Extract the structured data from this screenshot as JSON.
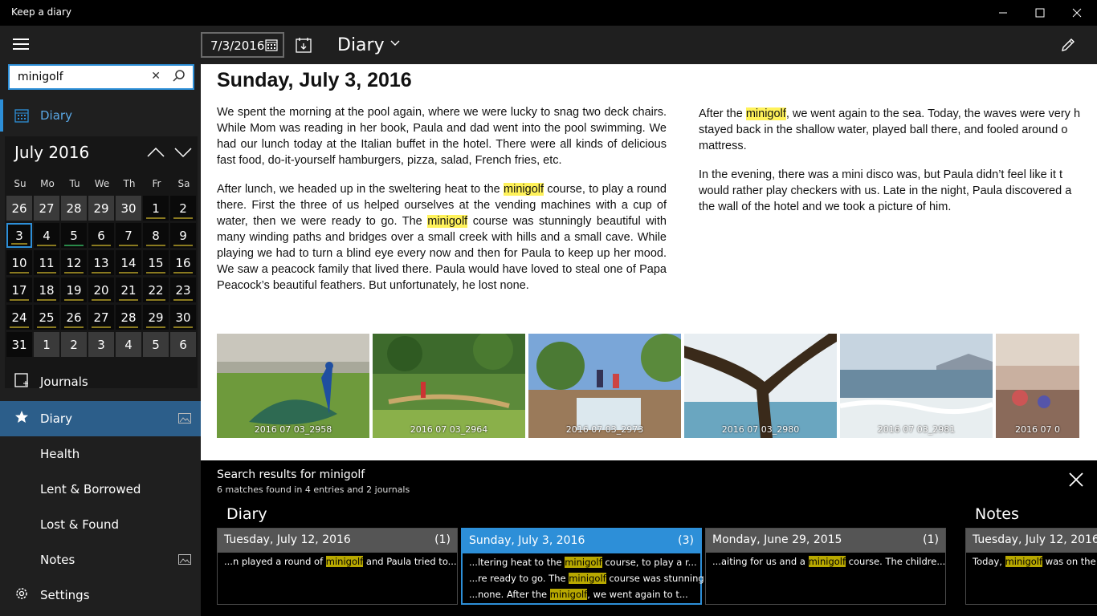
{
  "window": {
    "title": "Keep a diary",
    "minimize": "—",
    "maximize": "☐",
    "close": "✕"
  },
  "sidebar": {
    "search_value": "minigolf",
    "search_clear": "✕",
    "top_nav_label": "Diary",
    "calendar": {
      "month_label": "July 2016",
      "weekdays": [
        "Su",
        "Mo",
        "Tu",
        "We",
        "Th",
        "Fr",
        "Sa"
      ],
      "weeks": [
        [
          "26",
          "27",
          "28",
          "29",
          "30",
          "1",
          "2"
        ],
        [
          "3",
          "4",
          "5",
          "6",
          "7",
          "8",
          "9"
        ],
        [
          "10",
          "11",
          "12",
          "13",
          "14",
          "15",
          "16"
        ],
        [
          "17",
          "18",
          "19",
          "20",
          "21",
          "22",
          "23"
        ],
        [
          "24",
          "25",
          "26",
          "27",
          "28",
          "29",
          "30"
        ],
        [
          "31",
          "1",
          "2",
          "3",
          "4",
          "5",
          "6"
        ]
      ]
    },
    "journals_label": "Journals",
    "journals": [
      {
        "label": "Diary",
        "active": true,
        "has_image": true
      },
      {
        "label": "Health",
        "active": false,
        "has_image": false
      },
      {
        "label": "Lent & Borrowed",
        "active": false,
        "has_image": false
      },
      {
        "label": "Lost & Found",
        "active": false,
        "has_image": false
      },
      {
        "label": "Notes",
        "active": false,
        "has_image": true
      }
    ],
    "settings_label": "Settings"
  },
  "appbar": {
    "date_value": "7/3/2016",
    "journal_name": "Diary"
  },
  "entry": {
    "date_title": "Sunday, July 3, 2016",
    "col1_p1": "We spent the morning at the pool again, where we were lucky to snag two deck chairs. While Mom was reading in her book, Paula and dad went into the pool swimming. We had our lunch today at the Italian buffet in the hotel. There were all kinds of delicious fast food, do-it-yourself hamburgers, pizza, salad, French fries, etc.",
    "col1_p2_a": "After lunch, we headed up in the sweltering heat to the ",
    "col1_p2_b": " course, to play a round there. First the three of us helped ourselves at the vending machines with a cup of water, then we were ready to go. The ",
    "col1_p2_c": " course was stunningly beautiful with many winding paths and bridges over a small creek with hills and a small cave. While playing we had to turn a blind eye every now and then for Paula to keep up her mood. We saw a peacock family that lived there. Paula would have loved to steal one of Papa Peacock’s beautiful feathers. But unfortunately, he lost none.",
    "highlight": "minigolf",
    "col2_p1_a": "After the ",
    "col2_p1_b": ", we went again to the sea. Today, the waves were very h",
    "col2_p1_c": "stayed back in the shallow water, played ball there, and fooled around o",
    "col2_p1_d": "mattress.",
    "col2_p2_a": "In the evening, there was a mini disco was, but Paula didn’t feel like it t",
    "col2_p2_b": "would rather play checkers with us.  Late in the night, Paula discovered a",
    "col2_p2_c": "the wall of the hotel and we took a picture of him.",
    "photos": [
      {
        "caption": "2016 07 03_2958",
        "scene": "peacock-on-grass"
      },
      {
        "caption": "2016 07 03_2964",
        "scene": "minigolf-garden"
      },
      {
        "caption": "2016 07 03_2973",
        "scene": "waterfall-rocks"
      },
      {
        "caption": "2016 07 03_2980",
        "scene": "tree-by-sea"
      },
      {
        "caption": "2016 07 03_2981",
        "scene": "sea-waves"
      },
      {
        "caption": "2016 07 0",
        "scene": "hotel-terrace"
      }
    ]
  },
  "results": {
    "title": "Search results for minigolf",
    "subtitle": "6 matches found in 4 entries and 2 journals",
    "groups": [
      {
        "name": "Diary"
      },
      {
        "name": "Notes"
      }
    ],
    "cards": [
      {
        "date": "Tuesday, July 12, 2016",
        "count": "(1)",
        "snippets": [
          {
            "pre": "...n played a round of ",
            "hit": "minigolf",
            "post": " and Paula tried to..."
          }
        ]
      },
      {
        "date": "Sunday, July 3, 2016",
        "count": "(3)",
        "snippets": [
          {
            "pre": "...ltering heat to the ",
            "hit": "minigolf",
            "post": " course, to play a r..."
          },
          {
            "pre": "...re ready to go. The ",
            "hit": "minigolf",
            "post": " course was stunning..."
          },
          {
            "pre": "...none.  After the ",
            "hit": "minigolf",
            "post": ", we went again to t..."
          }
        ]
      },
      {
        "date": "Monday, June 29, 2015",
        "count": "(1)",
        "snippets": [
          {
            "pre": "...aiting for us and a ",
            "hit": "minigolf",
            "post": " course. The childre..."
          }
        ]
      },
      {
        "date": "Tuesday, July 12, 2016",
        "count": "",
        "snippets": [
          {
            "pre": "Today, ",
            "hit": "minigolf",
            "post": " was on the p"
          }
        ]
      }
    ]
  },
  "colors": {
    "accent": "#2d8fd8",
    "highlight": "#fff25a",
    "snippet_highlight": "#b8a800",
    "active_journal": "#2c5e8a"
  }
}
